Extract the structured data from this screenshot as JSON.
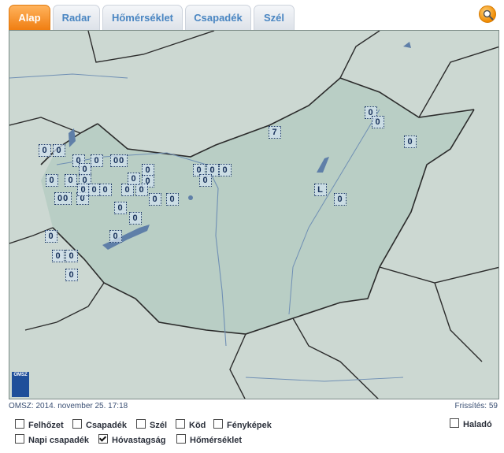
{
  "tabs": [
    "Alap",
    "Radar",
    "Hőmérséklet",
    "Csapadék",
    "Szél"
  ],
  "active_tab": 0,
  "search_icon": "search-icon",
  "map": {
    "logo_text": "OMSZ",
    "markers": [
      "0",
      "0",
      "0",
      "0",
      "0",
      "00",
      "0",
      "0",
      "0",
      "0",
      "0",
      "0",
      "00",
      "0",
      "0",
      "0",
      "0",
      "0",
      "0",
      "0",
      "0",
      "0",
      "0",
      "0",
      "0",
      "0",
      "0",
      "0",
      "0",
      "0",
      "0",
      "7",
      "0",
      "0",
      "0",
      "L",
      "0",
      "0"
    ],
    "colors": {
      "land": "#cdd9d3",
      "country": "#bcd0c7",
      "water": "#5f7fa8",
      "border": "#2b2b2b"
    }
  },
  "footer": {
    "left": "OMSZ: 2014. november 25. 17:18",
    "right": "Frissítés: 59"
  },
  "options": [
    {
      "label": "Felhőzet",
      "checked": false
    },
    {
      "label": "Csapadék",
      "checked": false
    },
    {
      "label": "Szél",
      "checked": false
    },
    {
      "label": "Köd",
      "checked": false
    },
    {
      "label": "Fényképek",
      "checked": false
    },
    {
      "label": "Haladó",
      "checked": false
    },
    {
      "label": "Napi csapadék",
      "checked": false
    },
    {
      "label": "Hóvastagság",
      "checked": true
    },
    {
      "label": "Hőmérséklet",
      "checked": false
    }
  ]
}
